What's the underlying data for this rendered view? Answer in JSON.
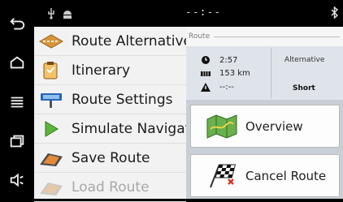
{
  "statusbar": {
    "time": "--:--",
    "icons": [
      "usb-icon",
      "android-icon",
      "bluetooth-icon"
    ]
  },
  "navbar": {
    "buttons": [
      "back-icon",
      "home-icon",
      "menu-icon",
      "recent-apps-icon",
      "volume-icon"
    ]
  },
  "menu": {
    "items": [
      {
        "label": "Route Alternatives",
        "icon": "route-alternatives-icon",
        "enabled": true
      },
      {
        "label": "Itinerary",
        "icon": "itinerary-icon",
        "enabled": true
      },
      {
        "label": "Route Settings",
        "icon": "route-settings-icon",
        "enabled": true
      },
      {
        "label": "Simulate Navigation",
        "icon": "simulate-navigation-icon",
        "enabled": true
      },
      {
        "label": "Save Route",
        "icon": "save-route-icon",
        "enabled": true
      },
      {
        "label": "Load Route",
        "icon": "load-route-icon",
        "enabled": false
      }
    ]
  },
  "route_panel": {
    "header": "Route",
    "stats": {
      "time": "2:57",
      "distance": "153 km",
      "warning": "--:--"
    },
    "alternative_label": "Alternative",
    "alternative_value": "Short",
    "buttons": [
      {
        "label": "Overview",
        "icon": "map-overview-icon"
      },
      {
        "label": "Cancel Route",
        "icon": "checkered-flag-icon"
      }
    ]
  },
  "colors": {
    "menu_bg": "#f2f2f2",
    "panel_bg": "#c9cfd6",
    "stats_bg": "#dfe4ea",
    "bar_bg": "#000000"
  }
}
